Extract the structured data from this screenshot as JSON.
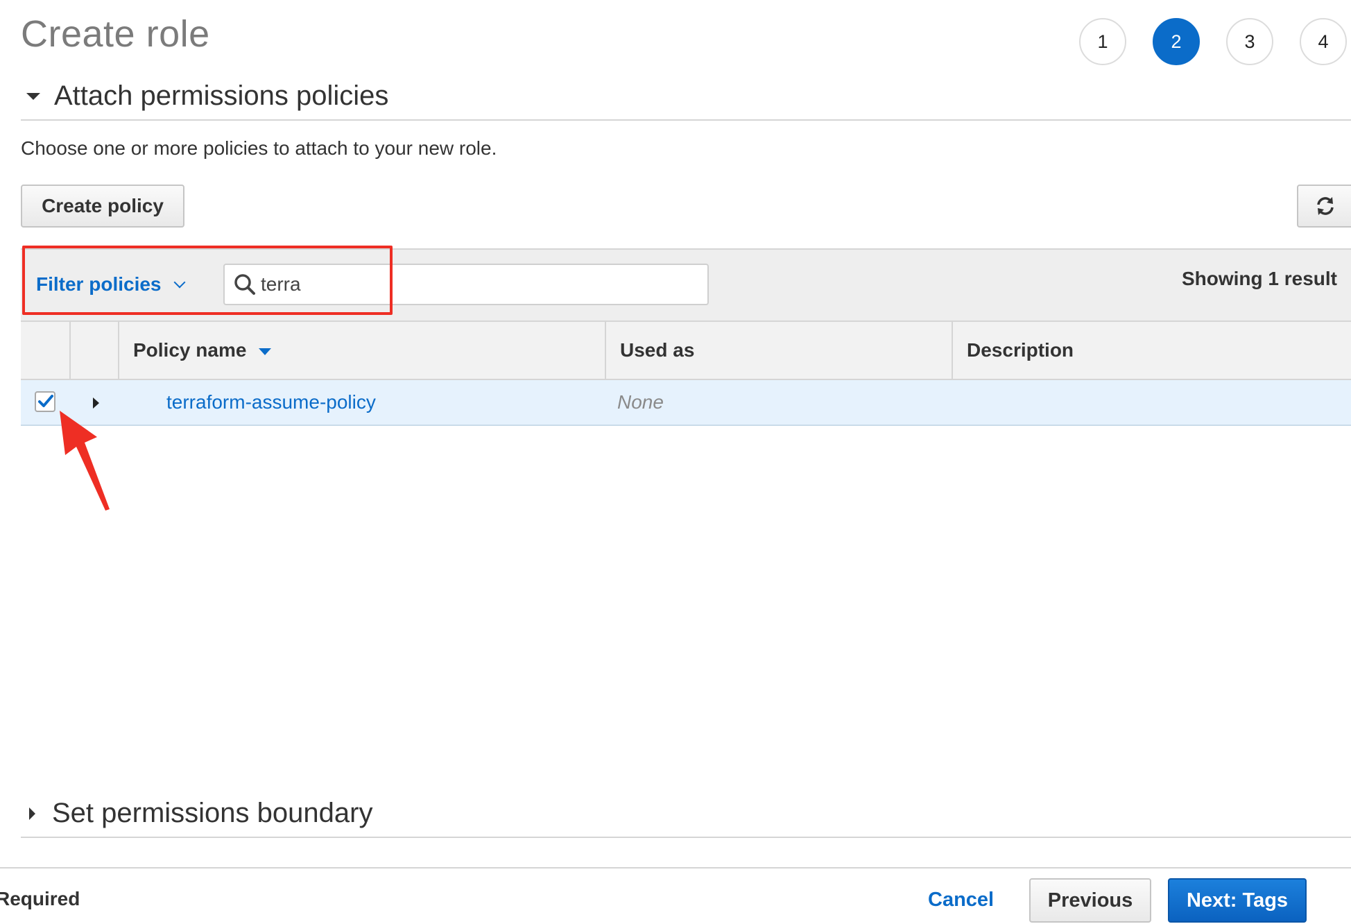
{
  "page": {
    "title": "Create role"
  },
  "steps": [
    {
      "label": "1",
      "active": false
    },
    {
      "label": "2",
      "active": true
    },
    {
      "label": "3",
      "active": false
    },
    {
      "label": "4",
      "active": false
    }
  ],
  "attach_section": {
    "title": "Attach permissions policies",
    "intro": "Choose one or more policies to attach to your new role.",
    "create_policy_label": "Create policy",
    "filter_label": "Filter policies",
    "search_value": "terra",
    "result_count_text": "Showing 1 result"
  },
  "table": {
    "columns": [
      "Policy name",
      "Used as",
      "Description"
    ],
    "rows": [
      {
        "checked": true,
        "policy_name": "terraform-assume-policy",
        "used_as": "None",
        "description": ""
      }
    ]
  },
  "boundary_section": {
    "title": "Set permissions boundary"
  },
  "footer": {
    "required_label": "Required",
    "cancel_label": "Cancel",
    "previous_label": "Previous",
    "next_label": "Next: Tags"
  },
  "colors": {
    "accent": "#0b6cc9",
    "annotation": "#ee2e24",
    "selected_row": "#e6f2fd"
  }
}
